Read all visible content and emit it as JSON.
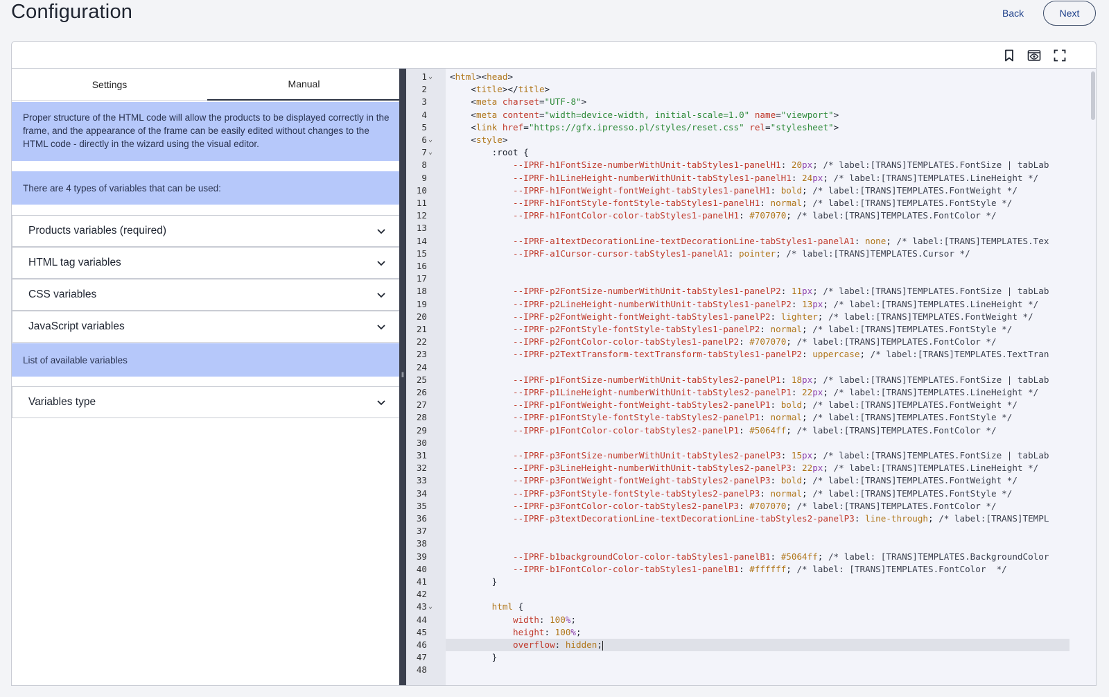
{
  "header": {
    "title": "Configuration",
    "back_label": "Back",
    "next_label": "Next"
  },
  "toolbar": {
    "icons": [
      "bookmark-icon",
      "preview-eye-icon",
      "fullscreen-icon"
    ]
  },
  "tabs": [
    {
      "label": "Settings",
      "active": false
    },
    {
      "label": "Manual",
      "active": true
    }
  ],
  "manual": {
    "intro": "Proper structure of the HTML code will allow the products to be displayed correctly in the frame, and the appearance of the frame can be easily edited without changes to the HTML code - directly in the wizard using the visual editor.",
    "types_note": "There are 4 types of variables that can be used:",
    "sections": [
      "Products variables (required)",
      "HTML tag variables",
      "CSS variables",
      "JavaScript variables"
    ],
    "list_note": "List of available variables",
    "sections_2": [
      "Variables type"
    ]
  },
  "editor": {
    "active_line": 46,
    "lines": [
      {
        "n": "1",
        "fold": true,
        "html": "<span class='t-sel'>&lt;</span><span class='t-tag'>html</span><span class='t-sel'>&gt;&lt;</span><span class='t-tag'>head</span><span class='t-sel'>&gt;</span>"
      },
      {
        "n": "2",
        "html": "    <span class='t-sel'>&lt;</span><span class='t-tag'>title</span><span class='t-sel'>&gt;&lt;/</span><span class='t-tag'>title</span><span class='t-sel'>&gt;</span>"
      },
      {
        "n": "3",
        "html": "    <span class='t-sel'>&lt;</span><span class='t-tag'>meta</span> <span class='t-attr'>charset</span>=<span class='t-str'>\"UTF-8\"</span><span class='t-sel'>&gt;</span>"
      },
      {
        "n": "4",
        "html": "    <span class='t-sel'>&lt;</span><span class='t-tag'>meta</span> <span class='t-attr'>content</span>=<span class='t-str'>\"width=device-width, initial-scale=1.0\"</span> <span class='t-attr'>name</span>=<span class='t-str'>\"viewport\"</span><span class='t-sel'>&gt;</span>"
      },
      {
        "n": "5",
        "html": "    <span class='t-sel'>&lt;</span><span class='t-tag'>link</span> <span class='t-attr'>href</span>=<span class='t-str'>\"https://gfx.ipresso.pl/styles/reset.css\"</span> <span class='t-attr'>rel</span>=<span class='t-str'>\"stylesheet\"</span><span class='t-sel'>&gt;</span>"
      },
      {
        "n": "6",
        "fold": true,
        "html": "    <span class='t-sel'>&lt;</span><span class='t-tag'>style</span><span class='t-sel'>&gt;</span>"
      },
      {
        "n": "7",
        "fold": true,
        "html": "        <span class='t-sel'>:root {</span>"
      },
      {
        "n": "8",
        "html": "            <span class='t-prop'>--IPRF-h1FontSize-numberWithUnit-tabStyles1-panelH1</span>: <span class='t-num'>20</span><span class='t-unit'>px</span>; <span class='t-com'>/* label:[TRANS]TEMPLATES.FontSize | tabLab</span>"
      },
      {
        "n": "9",
        "html": "            <span class='t-prop'>--IPRF-h1LineHeight-numberWithUnit-tabStyles1-panelH1</span>: <span class='t-num'>24</span><span class='t-unit'>px</span>; <span class='t-com'>/* label:[TRANS]TEMPLATES.LineHeight */</span>"
      },
      {
        "n": "10",
        "html": "            <span class='t-prop'>--IPRF-h1FontWeight-fontWeight-tabStyles1-panelH1</span>: <span class='t-kw'>bold</span>; <span class='t-com'>/* label:[TRANS]TEMPLATES.FontWeight */</span>"
      },
      {
        "n": "11",
        "html": "            <span class='t-prop'>--IPRF-h1FontStyle-fontStyle-tabStyles1-panelH1</span>: <span class='t-kw'>normal</span>; <span class='t-com'>/* label:[TRANS]TEMPLATES.FontStyle */</span>"
      },
      {
        "n": "12",
        "html": "            <span class='t-prop'>--IPRF-h1FontColor-color-tabStyles1-panelH1</span>: <span class='t-num'>#707070</span>; <span class='t-com'>/* label:[TRANS]TEMPLATES.FontColor */</span>"
      },
      {
        "n": "13",
        "html": ""
      },
      {
        "n": "14",
        "html": "            <span class='t-prop'>--IPRF-a1textDecorationLine-textDecorationLine-tabStyles1-panelA1</span>: <span class='t-kw'>none</span>; <span class='t-com'>/* label:[TRANS]TEMPLATES.Tex</span>"
      },
      {
        "n": "15",
        "html": "            <span class='t-prop'>--IPRF-a1Cursor-cursor-tabStyles1-panelA1</span>: <span class='t-kw'>pointer</span>; <span class='t-com'>/* label:[TRANS]TEMPLATES.Cursor */</span>"
      },
      {
        "n": "16",
        "html": ""
      },
      {
        "n": "17",
        "html": ""
      },
      {
        "n": "18",
        "html": "            <span class='t-prop'>--IPRF-p2FontSize-numberWithUnit-tabStyles1-panelP2</span>: <span class='t-num'>11</span><span class='t-unit'>px</span>; <span class='t-com'>/* label:[TRANS]TEMPLATES.FontSize | tabLab</span>"
      },
      {
        "n": "19",
        "html": "            <span class='t-prop'>--IPRF-p2LineHeight-numberWithUnit-tabStyles1-panelP2</span>: <span class='t-num'>13</span><span class='t-unit'>px</span>; <span class='t-com'>/* label:[TRANS]TEMPLATES.LineHeight */</span>"
      },
      {
        "n": "20",
        "html": "            <span class='t-prop'>--IPRF-p2FontWeight-fontWeight-tabStyles1-panelP2</span>: <span class='t-kw'>lighter</span>; <span class='t-com'>/* label:[TRANS]TEMPLATES.FontWeight */</span>"
      },
      {
        "n": "21",
        "html": "            <span class='t-prop'>--IPRF-p2FontStyle-fontStyle-tabStyles1-panelP2</span>: <span class='t-kw'>normal</span>; <span class='t-com'>/* label:[TRANS]TEMPLATES.FontStyle */</span>"
      },
      {
        "n": "22",
        "html": "            <span class='t-prop'>--IPRF-p2FontColor-color-tabStyles1-panelP2</span>: <span class='t-num'>#707070</span>; <span class='t-com'>/* label:[TRANS]TEMPLATES.FontColor */</span>"
      },
      {
        "n": "23",
        "html": "            <span class='t-prop'>--IPRF-p2TextTransform-textTransform-tabStyles1-panelP2</span>: <span class='t-kw'>uppercase</span>; <span class='t-com'>/* label:[TRANS]TEMPLATES.TextTran</span>"
      },
      {
        "n": "24",
        "html": ""
      },
      {
        "n": "25",
        "html": "            <span class='t-prop'>--IPRF-p1FontSize-numberWithUnit-tabStyles2-panelP1</span>: <span class='t-num'>18</span><span class='t-unit'>px</span>; <span class='t-com'>/* label:[TRANS]TEMPLATES.FontSize | tabLab</span>"
      },
      {
        "n": "26",
        "html": "            <span class='t-prop'>--IPRF-p1LineHeight-numberWithUnit-tabStyles2-panelP1</span>: <span class='t-num'>22</span><span class='t-unit'>px</span>; <span class='t-com'>/* label:[TRANS]TEMPLATES.LineHeight */</span>"
      },
      {
        "n": "27",
        "html": "            <span class='t-prop'>--IPRF-p1FontWeight-fontWeight-tabStyles2-panelP1</span>: <span class='t-kw'>bold</span>; <span class='t-com'>/* label:[TRANS]TEMPLATES.FontWeight */</span>"
      },
      {
        "n": "28",
        "html": "            <span class='t-prop'>--IPRF-p1FontStyle-fontStyle-tabStyles2-panelP1</span>: <span class='t-kw'>normal</span>; <span class='t-com'>/* label:[TRANS]TEMPLATES.FontStyle */</span>"
      },
      {
        "n": "29",
        "html": "            <span class='t-prop'>--IPRF-p1FontColor-color-tabStyles2-panelP1</span>: <span class='t-num'>#5064ff</span>; <span class='t-com'>/* label:[TRANS]TEMPLATES.FontColor */</span>"
      },
      {
        "n": "30",
        "html": ""
      },
      {
        "n": "31",
        "html": "            <span class='t-prop'>--IPRF-p3FontSize-numberWithUnit-tabStyles2-panelP3</span>: <span class='t-num'>15</span><span class='t-unit'>px</span>; <span class='t-com'>/* label:[TRANS]TEMPLATES.FontSize | tabLab</span>"
      },
      {
        "n": "32",
        "html": "            <span class='t-prop'>--IPRF-p3LineHeight-numberWithUnit-tabStyles2-panelP3</span>: <span class='t-num'>22</span><span class='t-unit'>px</span>; <span class='t-com'>/* label:[TRANS]TEMPLATES.LineHeight */</span>"
      },
      {
        "n": "33",
        "html": "            <span class='t-prop'>--IPRF-p3FontWeight-fontWeight-tabStyles2-panelP3</span>: <span class='t-kw'>bold</span>; <span class='t-com'>/* label:[TRANS]TEMPLATES.FontWeight */</span>"
      },
      {
        "n": "34",
        "html": "            <span class='t-prop'>--IPRF-p3FontStyle-fontStyle-tabStyles2-panelP3</span>: <span class='t-kw'>normal</span>; <span class='t-com'>/* label:[TRANS]TEMPLATES.FontStyle */</span>"
      },
      {
        "n": "35",
        "html": "            <span class='t-prop'>--IPRF-p3FontColor-color-tabStyles2-panelP3</span>: <span class='t-num'>#707070</span>; <span class='t-com'>/* label:[TRANS]TEMPLATES.FontColor */</span>"
      },
      {
        "n": "36",
        "html": "            <span class='t-prop'>--IPRF-p3textDecorationLine-textDecorationLine-tabStyles2-panelP3</span>: <span class='t-kw'>line-through</span>; <span class='t-com'>/* label:[TRANS]TEMPL</span>"
      },
      {
        "n": "37",
        "html": ""
      },
      {
        "n": "38",
        "html": ""
      },
      {
        "n": "39",
        "html": "            <span class='t-prop'>--IPRF-b1backgroundColor-color-tabStyles1-panelB1</span>: <span class='t-num'>#5064ff</span>; <span class='t-com'>/* label: [TRANS]TEMPLATES.BackgroundColor</span>"
      },
      {
        "n": "40",
        "html": "            <span class='t-prop'>--IPRF-b1FontColor-color-tabStyles1-panelB1</span>: <span class='t-num'>#ffffff</span>; <span class='t-com'>/* label: [TRANS]TEMPLATES.FontColor  */</span>"
      },
      {
        "n": "41",
        "html": "        <span class='t-sel'>}</span>"
      },
      {
        "n": "42",
        "html": ""
      },
      {
        "n": "43",
        "fold": true,
        "html": "        <span class='t-tag'>html</span> <span class='t-sel'>{</span>"
      },
      {
        "n": "44",
        "html": "            <span class='t-prop'>width</span>: <span class='t-num'>100</span><span class='t-unit'>%</span>;"
      },
      {
        "n": "45",
        "html": "            <span class='t-prop'>height</span>: <span class='t-num'>100</span><span class='t-unit'>%</span>;"
      },
      {
        "n": "46",
        "html": "            <span class='t-prop'>overflow</span>: <span class='t-kw'>hidden</span>;"
      },
      {
        "n": "47",
        "html": "        <span class='t-sel'>}</span>"
      },
      {
        "n": "48",
        "html": ""
      }
    ]
  }
}
